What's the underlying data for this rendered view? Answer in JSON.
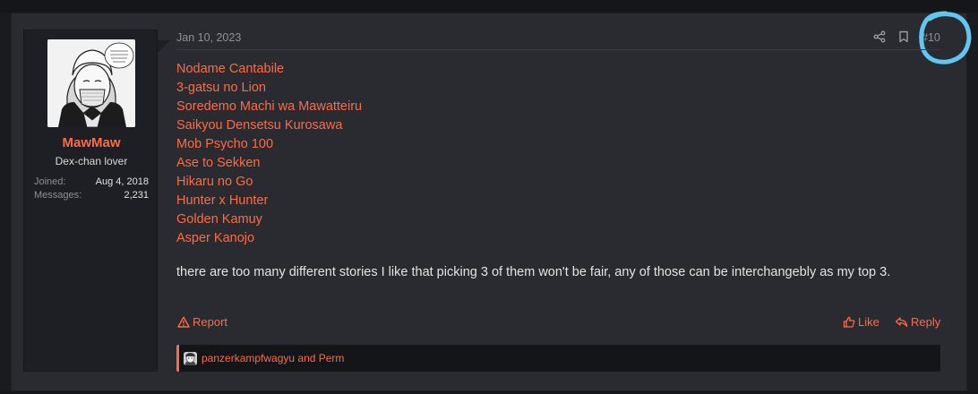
{
  "post": {
    "date": "Jan 10, 2023",
    "number": "#10",
    "author": {
      "username": "MawMaw",
      "title": "Dex-chan lover",
      "joined_label": "Joined:",
      "joined_value": "Aug 4, 2018",
      "messages_label": "Messages:",
      "messages_value": "2,231"
    },
    "titles": [
      "Nodame Cantabile",
      "3-gatsu no Lion",
      "Soredemo Machi wa Mawatteiru",
      "Saikyou Densetsu Kurosawa",
      "Mob Psycho 100",
      "Ase to Sekken",
      "Hikaru no Go",
      "Hunter x Hunter",
      "Golden Kamuy",
      "Asper Kanojo"
    ],
    "message": "there are too many different stories I like that picking 3 of them won't be fair, any of those can be interchangebly as my top 3.",
    "actions": {
      "report": "Report",
      "like": "Like",
      "reply": "Reply"
    },
    "reactions_text": "panzerkampfwagyu and Perm"
  },
  "colors": {
    "accent": "#ff6a43",
    "background": "#1a1b1f",
    "post_bg": "#2a2b30",
    "user_bg": "#1e1f24",
    "annotation_circle": "#5fc7f0"
  },
  "icons": [
    "share-icon",
    "bookmark-icon",
    "warning-icon",
    "thumbs-up-icon",
    "reply-icon"
  ]
}
